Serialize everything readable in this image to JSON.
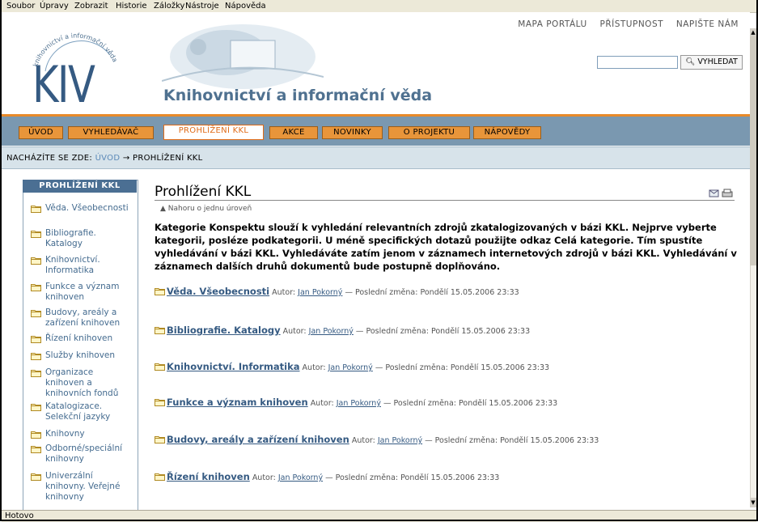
{
  "menu": [
    "Soubor",
    "Úpravy",
    "Zobrazit",
    "Historie",
    "Záložky",
    "Nástroje",
    "Nápověda"
  ],
  "status": "Hotovo",
  "header": {
    "top_links": [
      "MAPA PORTÁLU",
      "PŘÍSTUPNOST",
      "NAPIŠTE NÁM"
    ],
    "search_value": "",
    "search_button": "VYHLEDAT",
    "logo_text": "KIV",
    "logo_arc_text": "knihovnictví a informační věda",
    "site_title": "Knihovnictví a informační věda"
  },
  "nav": {
    "tabs": [
      "ÚVOD",
      "VYHLEDÁVAČ",
      "PROHLÍŽENÍ KKL",
      "AKCE",
      "NOVINKY",
      "O PROJEKTU",
      "NÁPOVĚDY"
    ],
    "active": "PROHLÍŽENÍ KKL"
  },
  "breadcrumb": {
    "prefix": "NACHÁZÍTE SE ZDE:",
    "home": "ÚVOD",
    "arrow": "→",
    "current": "PROHLÍŽENÍ KKL"
  },
  "sidebar": {
    "title": "PROHLÍŽENÍ KKL",
    "items": [
      "Věda. Všeobecnosti",
      "Bibliografie. Katalogy",
      "Knihovnictví. Informatika",
      "Funkce a význam knihoven",
      "Budovy, areály a zařízení knihoven",
      "Řízení knihoven",
      "Služby knihoven",
      "Organizace knihoven a knihovních fondů",
      "Katalogizace. Selekční jazyky",
      "Knihovny",
      "Odborné/speciální knihovny",
      "Univerzální knihovny. Veřejné knihovny"
    ]
  },
  "main": {
    "title": "Prohlížení KKL",
    "up_link": "Nahoru o jednu úroveň",
    "intro": "Kategorie Konspektu slouží k vyhledání relevantních zdrojů zkatalogizovaných v bázi KKL. Nejprve vyberte kategorii, posléze podkategorii. U méně specifických dotazů použijte odkaz Celá kategorie. Tím spustíte vyhledávání v bázi KKL. Vyhledáváte zatím jenom v záznamech internetových zdrojů v bázi KKL. Vyhledávání v záznamech dalších druhů dokumentů bude postupně doplňováno.",
    "entry_author_label": "Autor:",
    "entry_changed_label": "— Poslední změna:",
    "entries": [
      {
        "title": "Věda. Všeobecnosti",
        "author": "Jan Pokorný",
        "changed": "Pondělí 15.05.2006 23:33"
      },
      {
        "title": "Bibliografie. Katalogy",
        "author": "Jan Pokorný",
        "changed": "Pondělí 15.05.2006 23:33"
      },
      {
        "title": "Knihovnictví. Informatika",
        "author": "Jan Pokorný",
        "changed": "Pondělí 15.05.2006 23:33"
      },
      {
        "title": "Funkce a význam knihoven",
        "author": "Jan Pokorný",
        "changed": "Pondělí 15.05.2006 23:33"
      },
      {
        "title": "Budovy, areály a zařízení knihoven",
        "author": "Jan Pokorný",
        "changed": "Pondělí 15.05.2006 23:33"
      },
      {
        "title": "Řízení knihoven",
        "author": "Jan Pokorný",
        "changed": "Pondělí 15.05.2006 23:33"
      }
    ]
  },
  "colors": {
    "nav_orange": "#e8953a",
    "nav_blue": "#7a98b0",
    "sidebar_header": "#4b6f93",
    "link_blue": "#355a82"
  }
}
